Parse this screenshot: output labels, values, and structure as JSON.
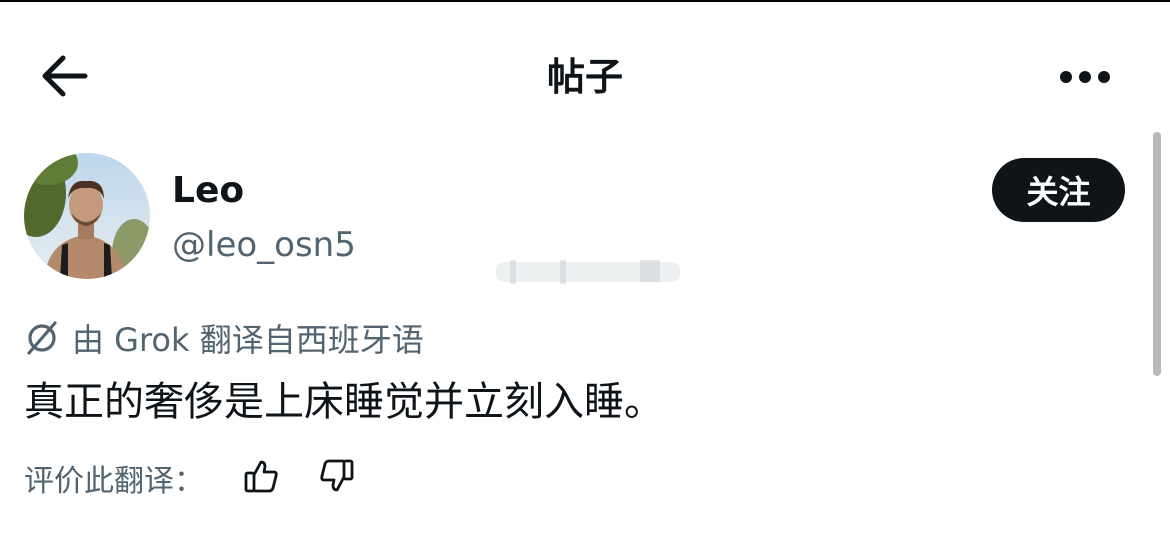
{
  "header": {
    "title": "帖子"
  },
  "icons": {
    "back": "arrow-left-icon",
    "more": "more-horizontal-icon",
    "grok": "grok-icon",
    "like": "thumbs-up-icon",
    "dislike": "thumbs-down-icon"
  },
  "author": {
    "name": "Leo",
    "handle": "@leo_osn5",
    "follow_label": "关注"
  },
  "translation": {
    "note": "由 Grok 翻译自西班牙语"
  },
  "post": {
    "text": "真正的奢侈是上床睡觉并立刻入睡。"
  },
  "rating": {
    "label": "评价此翻译："
  },
  "colors": {
    "primary_text": "#0f1419",
    "secondary_text": "#536471",
    "button_bg": "#0f1419"
  }
}
